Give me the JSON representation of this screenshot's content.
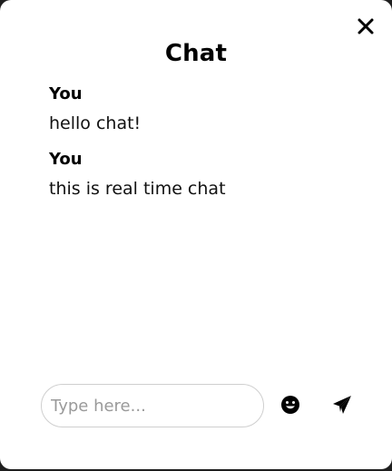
{
  "chat": {
    "title": "Chat",
    "messages": [
      {
        "author": "You",
        "text": "hello chat!"
      },
      {
        "author": "You",
        "text": "this is real time chat"
      }
    ]
  },
  "composer": {
    "placeholder": "Type here...",
    "value": ""
  },
  "icons": {
    "close": "close-icon",
    "emoji": "smiley-icon",
    "send": "paper-plane-icon"
  },
  "colors": {
    "background": "#ffffff",
    "text": "#000000",
    "input_border": "#cfcfcf",
    "placeholder": "#9a9a9a"
  }
}
